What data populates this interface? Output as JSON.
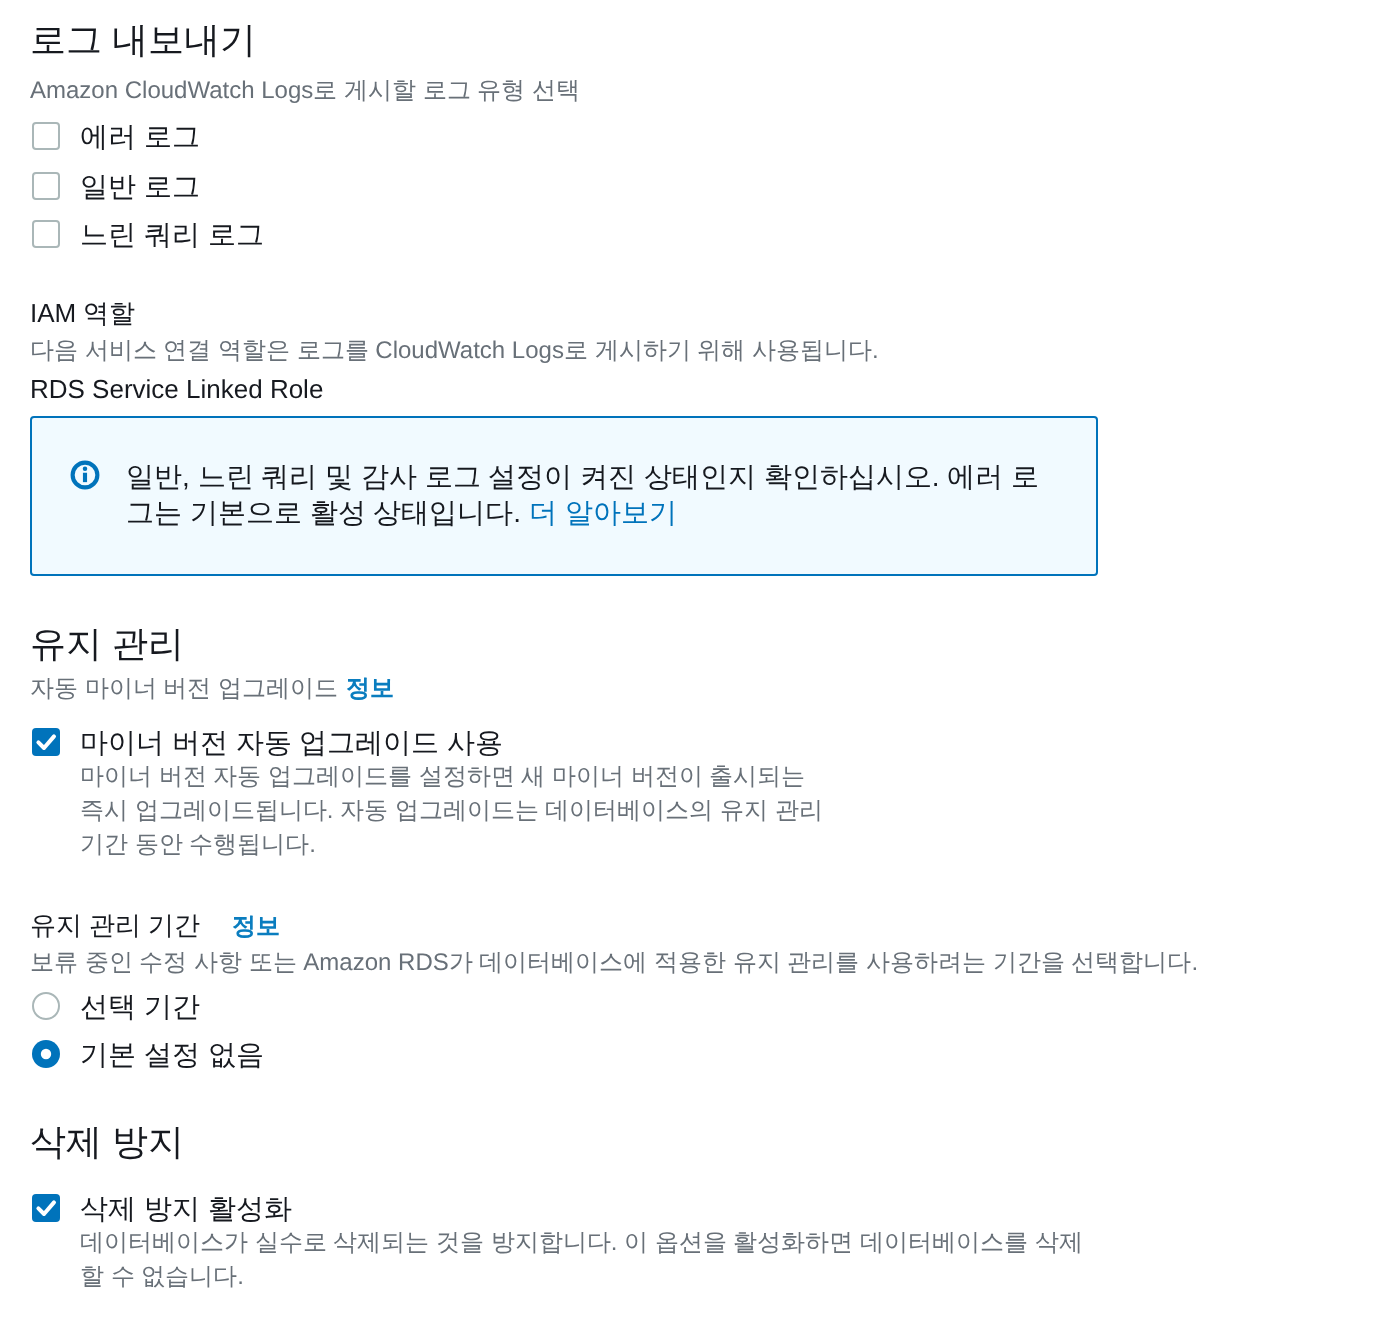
{
  "log_exports": {
    "title": "로그 내보내기",
    "description": "Amazon CloudWatch Logs로 게시할 로그 유형 선택",
    "options": [
      {
        "label": "에러 로그",
        "checked": false
      },
      {
        "label": "일반 로그",
        "checked": false
      },
      {
        "label": "느린 쿼리 로그",
        "checked": false
      }
    ]
  },
  "iam_role": {
    "label": "IAM 역할",
    "description": "다음 서비스 연결 역할은 로그를 CloudWatch Logs로 게시하기 위해 사용됩니다.",
    "value": "RDS Service Linked Role"
  },
  "info_alert": {
    "text": "일반, 느린 쿼리 및 감사 로그 설정이 켜진 상태인지 확인하십시오. 에러 로그는 기본으로 활성 상태입니다.",
    "link": "더 알아보기"
  },
  "maintenance": {
    "title": "유지 관리",
    "subtitle": "자동 마이너 버전 업그레이드",
    "subtitle_link": "정보",
    "auto_upgrade": {
      "label": "마이너 버전 자동 업그레이드 사용",
      "description": "마이너 버전 자동 업그레이드를 설정하면 새 마이너 버전이 출시되는 즉시 업그레이드됩니다. 자동 업그레이드는 데이터베이스의 유지 관리 기간 동안 수행됩니다.",
      "checked": true
    },
    "window": {
      "label": "유지 관리 기간",
      "info_link": "정보",
      "description": "보류 중인 수정 사항 또는 Amazon RDS가 데이터베이스에 적용한 유지 관리를 사용하려는 기간을 선택합니다.",
      "options": [
        {
          "label": "선택 기간",
          "selected": false
        },
        {
          "label": "기본 설정 없음",
          "selected": true
        }
      ]
    }
  },
  "deletion_protection": {
    "title": "삭제 방지",
    "option": {
      "label": "삭제 방지 활성화",
      "description": "데이터베이스가 실수로 삭제되는 것을 방지합니다. 이 옵션을 활성화하면 데이터베이스를 삭제할 수 없습니다.",
      "checked": true
    }
  }
}
